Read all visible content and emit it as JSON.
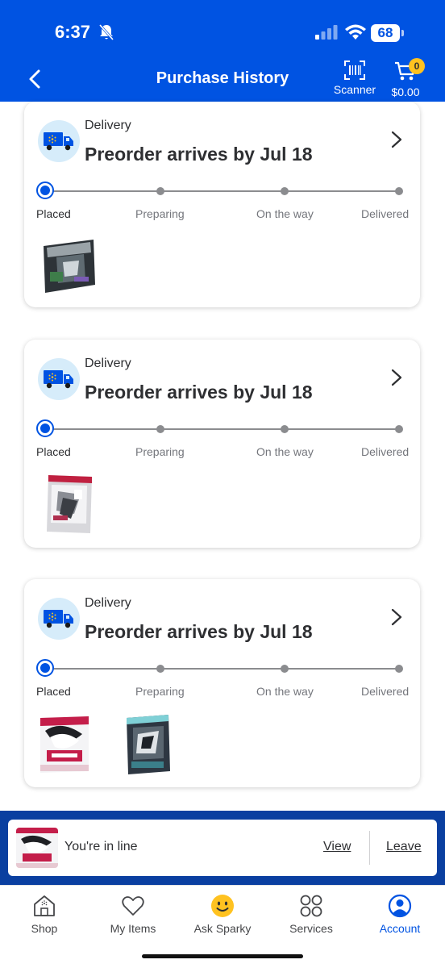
{
  "status_bar": {
    "time": "6:37",
    "battery": "68"
  },
  "header": {
    "title": "Purchase History",
    "scanner_label": "Scanner",
    "cart_total": "$0.00",
    "cart_count": "0"
  },
  "orders": [
    {
      "type": "Delivery",
      "arrival": "Preorder arrives by Jul 18",
      "steps": [
        "Placed",
        "Preparing",
        "On the way",
        "Delivered"
      ],
      "current_step": 0
    },
    {
      "type": "Delivery",
      "arrival": "Preorder arrives by Jul 18",
      "steps": [
        "Placed",
        "Preparing",
        "On the way",
        "Delivered"
      ],
      "current_step": 0
    },
    {
      "type": "Delivery",
      "arrival": "Preorder arrives by Jul 18",
      "steps": [
        "Placed",
        "Preparing",
        "On the way",
        "Delivered"
      ],
      "current_step": 0
    }
  ],
  "queue_banner": {
    "text": "You're in line",
    "view": "View",
    "leave": "Leave"
  },
  "tabs": [
    {
      "label": "Shop",
      "icon": "store-icon"
    },
    {
      "label": "My Items",
      "icon": "heart-icon"
    },
    {
      "label": "Ask Sparky",
      "icon": "sparky-icon"
    },
    {
      "label": "Services",
      "icon": "services-icon"
    },
    {
      "label": "Account",
      "icon": "account-icon"
    }
  ],
  "colors": {
    "brand_blue": "#0053e2",
    "banner_blue": "#0a3fa0",
    "sparky_yellow": "#ffc220"
  }
}
